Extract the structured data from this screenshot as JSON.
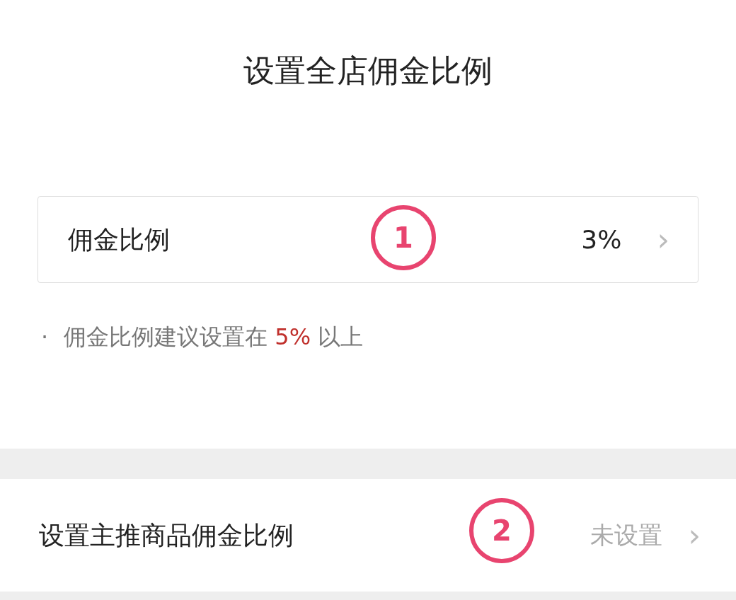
{
  "title": "设置全店佣金比例",
  "commission": {
    "label": "佣金比例",
    "value": "3%",
    "chevron": "›",
    "badge": "1"
  },
  "note": {
    "bullet": "·",
    "before": "佣金比例建议设置在",
    "highlight": "5%",
    "after": "以上"
  },
  "featured": {
    "label": "设置主推商品佣金比例",
    "value": "未设置",
    "chevron": "›",
    "badge": "2"
  }
}
